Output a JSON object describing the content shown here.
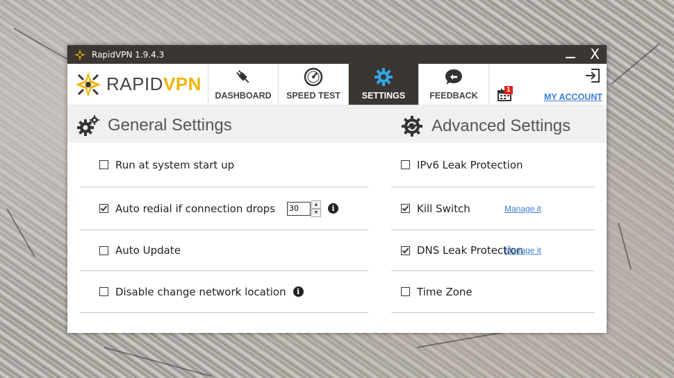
{
  "titlebar": {
    "title": "RapidVPN 1.9.4.3",
    "close_glyph": "X"
  },
  "logo": {
    "part1": "RAPID",
    "part2": "VPN",
    "brand_color": "#f0b400"
  },
  "nav": {
    "tabs": [
      {
        "label": "DASHBOARD",
        "icon": "plug-icon"
      },
      {
        "label": "SPEED TEST",
        "icon": "speedometer-icon"
      },
      {
        "label": "SETTINGS",
        "icon": "gear-icon",
        "active": true
      },
      {
        "label": "FEEDBACK",
        "icon": "chat-bubble-icon"
      }
    ],
    "calendar_badge": "1",
    "my_account": "MY ACCOUNT",
    "active_tab_color": "#3b3632",
    "link_color": "#3a7cd6"
  },
  "general": {
    "title": "General Settings",
    "items": [
      {
        "label": "Run at system start up",
        "checked": false
      },
      {
        "label": "Auto redial if connection drops",
        "checked": true,
        "spinner_value": "30"
      },
      {
        "label": "Auto Update",
        "checked": false
      },
      {
        "label": "Disable change network location",
        "checked": false
      }
    ]
  },
  "advanced": {
    "title": "Advanced Settings",
    "items": [
      {
        "label": "IPv6 Leak Protection",
        "checked": false
      },
      {
        "label": "Kill Switch",
        "checked": true,
        "link": "Manage it"
      },
      {
        "label": "DNS Leak Protection",
        "checked": true,
        "link": "Manage it"
      },
      {
        "label": "Time Zone",
        "checked": false
      }
    ]
  }
}
